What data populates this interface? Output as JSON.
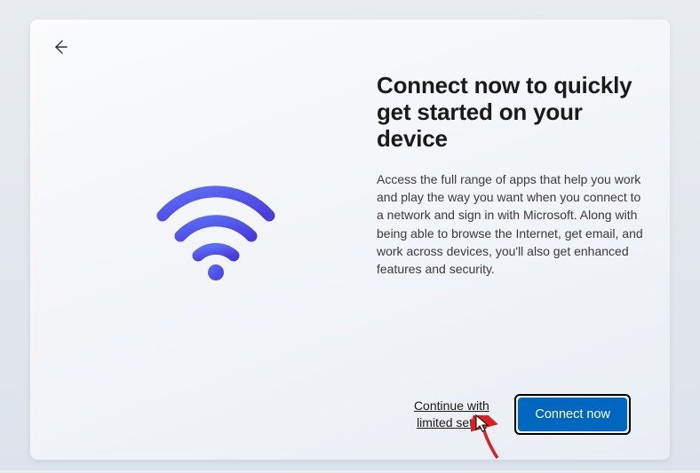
{
  "title": "Connect now to quickly get started on your device",
  "body": "Access the full range of apps that help you work and play the way you want when you connect to a network and sign in with Microsoft. Along with being able to browse the Internet, get email, and work across devices, you'll also get enhanced features and security.",
  "actions": {
    "secondary_label": "Continue with limited setup",
    "primary_label": "Connect now"
  },
  "colors": {
    "accent": "#0067c0",
    "wifi_gradient_start": "#5b6ef5",
    "wifi_gradient_end": "#4a3cdc"
  }
}
